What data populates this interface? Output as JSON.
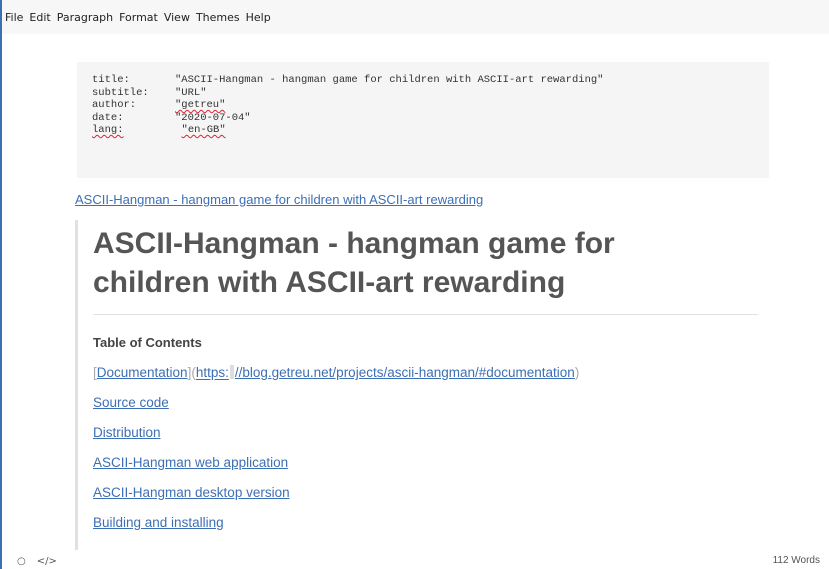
{
  "menu": [
    "File",
    "Edit",
    "Paragraph",
    "Format",
    "View",
    "Themes",
    "Help"
  ],
  "frontmatter": [
    {
      "key": "title:",
      "value": "\"ASCII-Hangman - hangman game for children with ASCII-art rewarding\""
    },
    {
      "key": "subtitle:",
      "value": "\"URL\""
    },
    {
      "key": "author:",
      "value": "\"getreu\""
    },
    {
      "key": "date:",
      "value": "\"2020-07-04\""
    },
    {
      "key": "lang:",
      "value": "\"en-GB\""
    }
  ],
  "top_link": "ASCII-Hangman - hangman game for children with ASCII-art rewarding",
  "heading": "ASCII-Hangman - hangman game for children with ASCII-art rewarding",
  "toc_title": "Table of Contents",
  "md_link": {
    "open": "[",
    "text": "Documentation",
    "mid": "](",
    "url_a": "https:",
    "url_b": "//blog.getreu.net/projects/ascii-hangman/#documentation",
    "close": ")"
  },
  "toc_links": [
    "Source code",
    "Distribution",
    "ASCII-Hangman web application",
    "ASCII-Hangman desktop version",
    "Building and installing"
  ],
  "status": {
    "icon_left": "○",
    "icon_code": "</>",
    "word_count": "112 Words"
  },
  "colors": {
    "link": "#3d6fb5",
    "heading": "#555555",
    "codeblock_bg": "#f5f5f5"
  }
}
